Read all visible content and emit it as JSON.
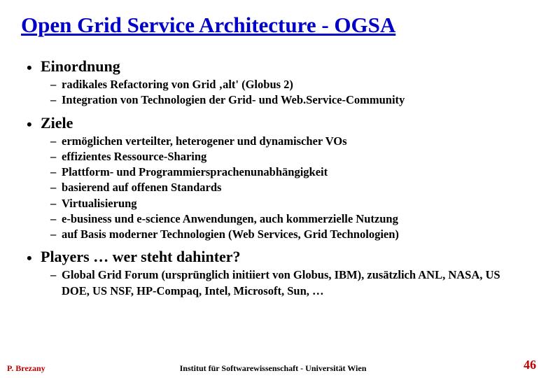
{
  "title": "Open Grid Service Architecture - OGSA",
  "sections": [
    {
      "heading": "Einordnung",
      "items": [
        "radikales Refactoring von Grid ‚alt' (Globus 2)",
        "Integration von Technologien der Grid- und Web.Service-Community"
      ]
    },
    {
      "heading": "Ziele",
      "items": [
        "ermöglichen verteilter, heterogener und dynamischer VOs",
        "effizientes Ressource-Sharing",
        "Plattform- und Programmiersprachenunabhängigkeit",
        "basierend auf offenen Standards",
        "Virtualisierung",
        "e-business und e-science Anwendungen, auch kommerzielle Nutzung",
        "auf Basis moderner Technologien (Web Services, Grid Technologien)"
      ]
    },
    {
      "heading": "Players … wer steht dahinter?",
      "items": [
        "Global Grid Forum (ursprünglich initiiert von Globus, IBM), zusätzlich ANL, NASA, US DOE, US NSF, HP-Compaq, Intel, Microsoft, Sun, …"
      ]
    }
  ],
  "footer": {
    "author": "P. Brezany",
    "institute": "Institut für Softwarewissenschaft - Universität Wien",
    "page": "46"
  }
}
